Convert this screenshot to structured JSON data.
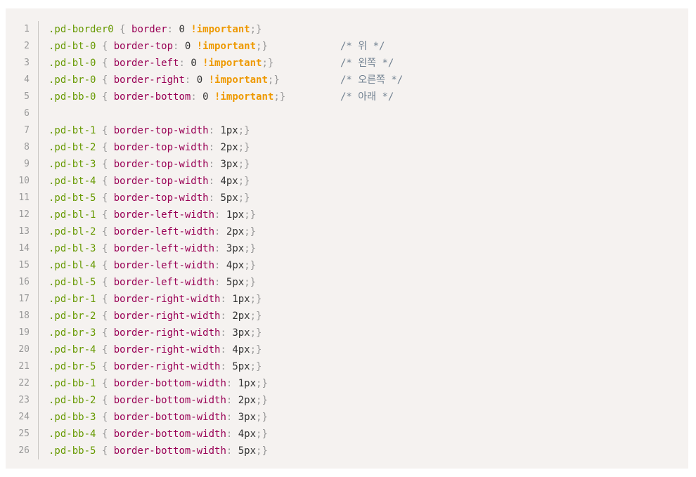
{
  "lines": [
    {
      "num": "1",
      "selector": ".pd-border0",
      "open": " { ",
      "property": "border",
      "colon": ": ",
      "value": "0",
      "important": " !important",
      "close": ";}",
      "comment": ""
    },
    {
      "num": "2",
      "selector": ".pd-bt-0",
      "open": " { ",
      "property": "border-top",
      "colon": ": ",
      "value": "0",
      "important": " !important",
      "close": ";}",
      "comment": "/* 위 */"
    },
    {
      "num": "3",
      "selector": ".pd-bl-0",
      "open": " { ",
      "property": "border-left",
      "colon": ": ",
      "value": "0",
      "important": " !important",
      "close": ";}",
      "comment": "/* 왼쪽 */"
    },
    {
      "num": "4",
      "selector": ".pd-br-0",
      "open": " { ",
      "property": "border-right",
      "colon": ": ",
      "value": "0",
      "important": " !important",
      "close": ";}",
      "comment": "/* 오른쪽 */"
    },
    {
      "num": "5",
      "selector": ".pd-bb-0",
      "open": " { ",
      "property": "border-bottom",
      "colon": ": ",
      "value": "0",
      "important": " !important",
      "close": ";}",
      "comment": "/* 아래 */"
    },
    {
      "num": "6",
      "selector": "",
      "open": "",
      "property": "",
      "colon": "",
      "value": "",
      "important": "",
      "close": "",
      "comment": ""
    },
    {
      "num": "7",
      "selector": ".pd-bt-1",
      "open": " { ",
      "property": "border-top-width",
      "colon": ": ",
      "value": "1px",
      "important": "",
      "close": ";}",
      "comment": ""
    },
    {
      "num": "8",
      "selector": ".pd-bt-2",
      "open": " { ",
      "property": "border-top-width",
      "colon": ": ",
      "value": "2px",
      "important": "",
      "close": ";}",
      "comment": ""
    },
    {
      "num": "9",
      "selector": ".pd-bt-3",
      "open": " { ",
      "property": "border-top-width",
      "colon": ": ",
      "value": "3px",
      "important": "",
      "close": ";}",
      "comment": ""
    },
    {
      "num": "10",
      "selector": ".pd-bt-4",
      "open": " { ",
      "property": "border-top-width",
      "colon": ": ",
      "value": "4px",
      "important": "",
      "close": ";}",
      "comment": ""
    },
    {
      "num": "11",
      "selector": ".pd-bt-5",
      "open": " { ",
      "property": "border-top-width",
      "colon": ": ",
      "value": "5px",
      "important": "",
      "close": ";}",
      "comment": ""
    },
    {
      "num": "12",
      "selector": ".pd-bl-1",
      "open": " { ",
      "property": "border-left-width",
      "colon": ": ",
      "value": "1px",
      "important": "",
      "close": ";}",
      "comment": ""
    },
    {
      "num": "13",
      "selector": ".pd-bl-2",
      "open": " { ",
      "property": "border-left-width",
      "colon": ": ",
      "value": "2px",
      "important": "",
      "close": ";}",
      "comment": ""
    },
    {
      "num": "14",
      "selector": ".pd-bl-3",
      "open": " { ",
      "property": "border-left-width",
      "colon": ": ",
      "value": "3px",
      "important": "",
      "close": ";}",
      "comment": ""
    },
    {
      "num": "15",
      "selector": ".pd-bl-4",
      "open": " { ",
      "property": "border-left-width",
      "colon": ": ",
      "value": "4px",
      "important": "",
      "close": ";}",
      "comment": ""
    },
    {
      "num": "16",
      "selector": ".pd-bl-5",
      "open": " { ",
      "property": "border-left-width",
      "colon": ": ",
      "value": "5px",
      "important": "",
      "close": ";}",
      "comment": ""
    },
    {
      "num": "17",
      "selector": ".pd-br-1",
      "open": " { ",
      "property": "border-right-width",
      "colon": ": ",
      "value": "1px",
      "important": "",
      "close": ";}",
      "comment": ""
    },
    {
      "num": "18",
      "selector": ".pd-br-2",
      "open": " { ",
      "property": "border-right-width",
      "colon": ": ",
      "value": "2px",
      "important": "",
      "close": ";}",
      "comment": ""
    },
    {
      "num": "19",
      "selector": ".pd-br-3",
      "open": " { ",
      "property": "border-right-width",
      "colon": ": ",
      "value": "3px",
      "important": "",
      "close": ";}",
      "comment": ""
    },
    {
      "num": "20",
      "selector": ".pd-br-4",
      "open": " { ",
      "property": "border-right-width",
      "colon": ": ",
      "value": "4px",
      "important": "",
      "close": ";}",
      "comment": ""
    },
    {
      "num": "21",
      "selector": ".pd-br-5",
      "open": " { ",
      "property": "border-right-width",
      "colon": ": ",
      "value": "5px",
      "important": "",
      "close": ";}",
      "comment": ""
    },
    {
      "num": "22",
      "selector": ".pd-bb-1",
      "open": " { ",
      "property": "border-bottom-width",
      "colon": ": ",
      "value": "1px",
      "important": "",
      "close": ";}",
      "comment": ""
    },
    {
      "num": "23",
      "selector": ".pd-bb-2",
      "open": " { ",
      "property": "border-bottom-width",
      "colon": ": ",
      "value": "2px",
      "important": "",
      "close": ";}",
      "comment": ""
    },
    {
      "num": "24",
      "selector": ".pd-bb-3",
      "open": " { ",
      "property": "border-bottom-width",
      "colon": ": ",
      "value": "3px",
      "important": "",
      "close": ";}",
      "comment": ""
    },
    {
      "num": "25",
      "selector": ".pd-bb-4",
      "open": " { ",
      "property": "border-bottom-width",
      "colon": ": ",
      "value": "4px",
      "important": "",
      "close": ";}",
      "comment": ""
    },
    {
      "num": "26",
      "selector": ".pd-bb-5",
      "open": " { ",
      "property": "border-bottom-width",
      "colon": ": ",
      "value": "5px",
      "important": "",
      "close": ";}",
      "comment": ""
    }
  ],
  "colors": {
    "background": "#f5f2f0",
    "selector": "#669900",
    "property": "#990055",
    "important": "#ee9900",
    "punctuation": "#999999",
    "comment": "#708090",
    "line_number": "#999999"
  }
}
